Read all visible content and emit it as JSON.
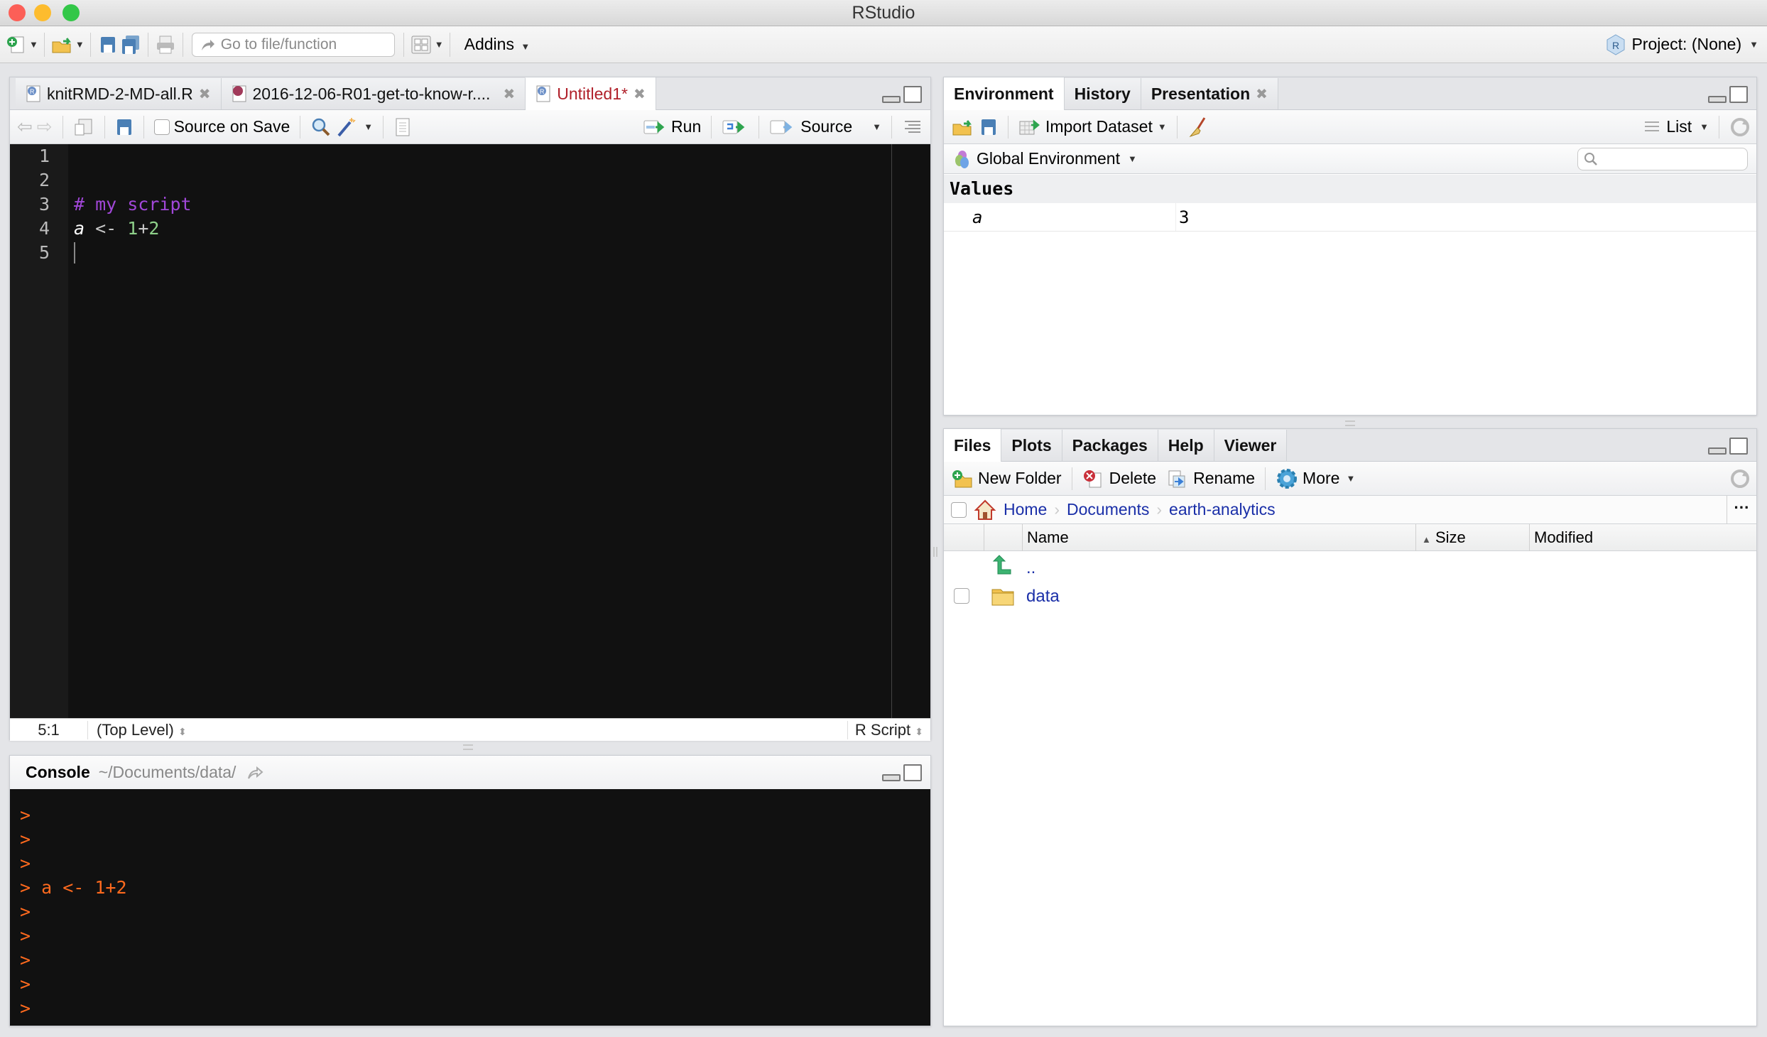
{
  "window": {
    "title": "RStudio",
    "traffic_lights": {
      "close": "#fc5f57",
      "minimize": "#fdbc2e",
      "zoom": "#33c748"
    }
  },
  "toolbar": {
    "new_file_icon": "new-file-icon",
    "open_icon": "open-file-icon",
    "save_icon": "save-icon",
    "save_all_icon": "save-all-icon",
    "print_icon": "print-icon",
    "goto_placeholder": "Go to file/function",
    "layout_icon": "pane-layout-icon",
    "addins_label": "Addins",
    "project_label": "Project: (None)"
  },
  "editor": {
    "tabs": [
      {
        "label": "knitRMD-2-MD-all.R",
        "active": false
      },
      {
        "label": "2016-12-06-R01-get-to-know-r....",
        "active": false
      },
      {
        "label": "Untitled1*",
        "active": true
      }
    ],
    "toolbar": {
      "source_on_save": "Source on Save",
      "run": "Run",
      "source": "Source"
    },
    "lines": [
      {
        "n": "1",
        "tokens": []
      },
      {
        "n": "2",
        "tokens": []
      },
      {
        "n": "3",
        "tokens": [
          {
            "t": "# my script",
            "c": "#a147d8"
          }
        ]
      },
      {
        "n": "4",
        "tokens": [
          {
            "t": "a",
            "c": "#ffffff",
            "i": true
          },
          {
            "t": " <- ",
            "c": "#c8c8c8"
          },
          {
            "t": "1",
            "c": "#8fd18a"
          },
          {
            "t": "+",
            "c": "#c8c8c8"
          },
          {
            "t": "2",
            "c": "#8fd18a"
          }
        ]
      },
      {
        "n": "5",
        "tokens": []
      }
    ],
    "status": {
      "position": "5:1",
      "scope": "(Top Level)",
      "file_type": "R Script"
    }
  },
  "console": {
    "title": "Console",
    "path": "~/Documents/data/",
    "lines": [
      ">",
      ">",
      ">",
      "> a <- 1+2",
      ">",
      ">",
      ">",
      ">",
      ">"
    ],
    "text_color": "#ff6a1e"
  },
  "environment": {
    "tabs": [
      {
        "label": "Environment",
        "active": true
      },
      {
        "label": "History",
        "active": false
      },
      {
        "label": "Presentation",
        "active": false,
        "closable": true
      }
    ],
    "toolbar": {
      "import_dataset": "Import Dataset",
      "view_mode": "List"
    },
    "scope": "Global Environment",
    "search_placeholder": "",
    "section": "Values",
    "values": [
      {
        "name": "a",
        "value": "3"
      }
    ]
  },
  "files": {
    "tabs": [
      {
        "label": "Files",
        "active": true
      },
      {
        "label": "Plots"
      },
      {
        "label": "Packages"
      },
      {
        "label": "Help"
      },
      {
        "label": "Viewer"
      }
    ],
    "toolbar": {
      "new_folder": "New Folder",
      "delete": "Delete",
      "rename": "Rename",
      "more": "More"
    },
    "breadcrumb": [
      "Home",
      "Documents",
      "earth-analytics"
    ],
    "columns": {
      "name": "Name",
      "size": "Size",
      "modified": "Modified"
    },
    "rows": [
      {
        "name": "..",
        "type": "parent"
      },
      {
        "name": "data",
        "type": "folder"
      }
    ]
  }
}
